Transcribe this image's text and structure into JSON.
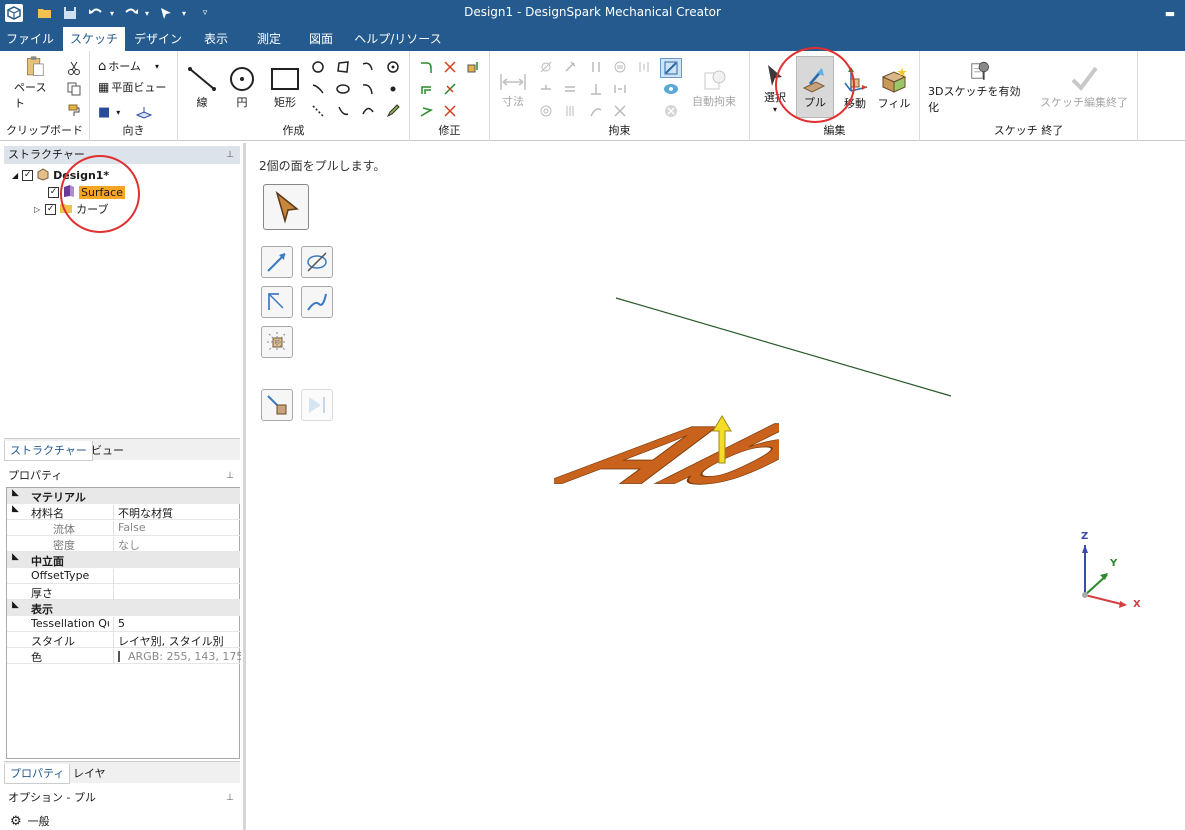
{
  "window": {
    "title": "Design1 - DesignSpark Mechanical Creator"
  },
  "menu": {
    "tabs": [
      "ファイル",
      "スケッチ",
      "デザイン",
      "表示",
      "測定",
      "図面",
      "ヘルプ/リソース"
    ],
    "active": "スケッチ"
  },
  "ribbon": {
    "clipboard": {
      "label": "クリップボード",
      "paste": "ペースト"
    },
    "orient": {
      "label": "向き",
      "home": "ホーム",
      "plan_view": "平面ビュー"
    },
    "create": {
      "label": "作成",
      "line": "線",
      "circle": "円",
      "rect": "矩形"
    },
    "modify": {
      "label": "修正"
    },
    "constraint": {
      "label": "拘束",
      "dimension": "寸法",
      "auto": "自動拘束"
    },
    "edit": {
      "label": "編集",
      "select": "選択",
      "pull": "プル",
      "move": "移動",
      "fill": "フィル"
    },
    "sketch_end": {
      "label": "スケッチ 終了",
      "enable_3d": "3Dスケッチを有効化",
      "finish": "スケッチ編集終了"
    }
  },
  "structure": {
    "title": "ストラクチャー",
    "root": "Design1*",
    "items": [
      "Surface",
      "カーブ"
    ],
    "tabs": [
      "ストラクチャー",
      "ビュー"
    ]
  },
  "properties": {
    "title": "プロパティ",
    "rows": [
      {
        "k": "マテリアル",
        "v": ""
      },
      {
        "k": "材料名",
        "v": "不明な材質"
      },
      {
        "k": "流体",
        "v": "False"
      },
      {
        "k": "密度",
        "v": "なし"
      },
      {
        "k": "中立面",
        "v": ""
      },
      {
        "k": "OffsetType",
        "v": ""
      },
      {
        "k": "厚さ",
        "v": ""
      },
      {
        "k": "表示",
        "v": ""
      },
      {
        "k": "Tessellation Qua",
        "v": "5"
      },
      {
        "k": "スタイル",
        "v": "レイヤ別, スタイル別"
      },
      {
        "k": "色",
        "v": "ARGB: 255, 143, 175"
      }
    ],
    "color_swatch": "#9fb79a",
    "tabs": [
      "プロパティ",
      "レイヤ"
    ]
  },
  "options": {
    "title": "オプション - プル",
    "section": "一般"
  },
  "canvas": {
    "hint": "2個の面をプルします。",
    "text_3d": "Ab",
    "text_color": "#c8621c",
    "triad": {
      "z": "Z",
      "y": "Y",
      "x": "X"
    }
  },
  "colors": {
    "titlebar": "#245a8d",
    "highlight": "#e03030",
    "accent_orange": "#f5a623"
  }
}
